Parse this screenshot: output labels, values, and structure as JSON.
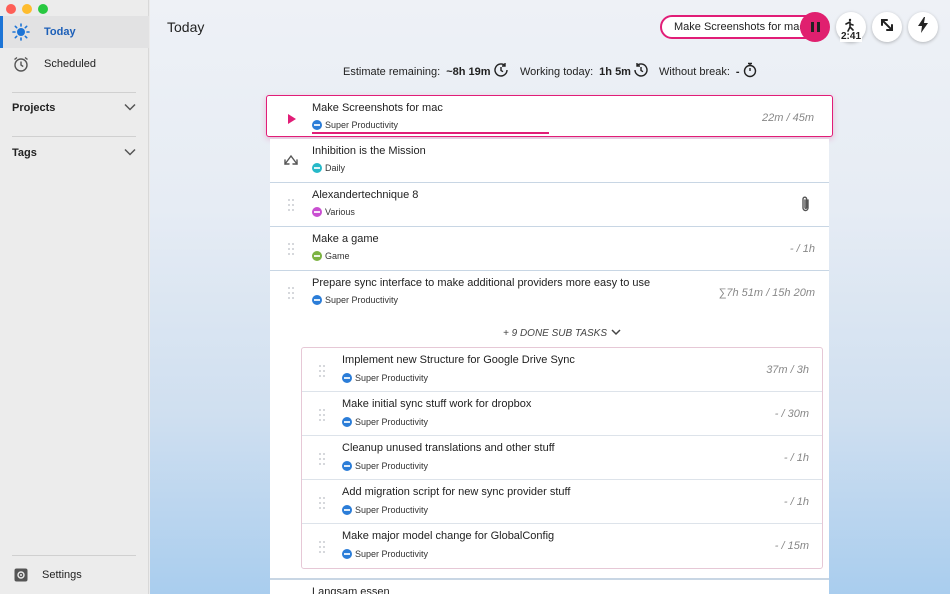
{
  "sidebar": {
    "today": "Today",
    "scheduled": "Scheduled",
    "projects": "Projects",
    "tags": "Tags",
    "settings": "Settings"
  },
  "header": {
    "title": "Today",
    "current_task": "Make Screenshots for mac",
    "timer_badge": "2:41"
  },
  "stats": {
    "estimate_label": "Estimate remaining:",
    "estimate_value": "~8h 19m",
    "working_label": "Working today:",
    "working_value": "1h 5m",
    "break_label": "Without break:",
    "break_value": "-"
  },
  "colors": {
    "accent": "#e11d77",
    "super_productivity": "#2b7dd8",
    "daily": "#26b9c8",
    "various": "#c94fd1",
    "game": "#7cb342"
  },
  "tasks": [
    {
      "title": "Make Screenshots for mac",
      "project": "Super Productivity",
      "time": "22m / 45m",
      "progress": 0.49
    },
    {
      "title": "Inhibition is the Mission",
      "project": "Daily",
      "time": ""
    },
    {
      "title": "Alexandertechnique 8",
      "project": "Various",
      "time": ""
    },
    {
      "title": "Make a game",
      "project": "Game",
      "time": "- / 1h"
    },
    {
      "title": "Prepare sync interface to make additional providers more easy to use",
      "project": "Super Productivity",
      "time": "∑7h 51m / 15h 20m"
    }
  ],
  "subtasks_toggle": "+ 9 DONE SUB TASKS",
  "subtasks": [
    {
      "title": "Implement new Structure for Google Drive Sync",
      "project": "Super Productivity",
      "time": "37m / 3h"
    },
    {
      "title": "Make initial sync stuff work for dropbox",
      "project": "Super Productivity",
      "time": "- / 30m"
    },
    {
      "title": "Cleanup unused translations and other stuff",
      "project": "Super Productivity",
      "time": "- / 1h"
    },
    {
      "title": "Add migration script for new sync provider stuff",
      "project": "Super Productivity",
      "time": "- / 1h"
    },
    {
      "title": "Make major model change for GlobalConfig",
      "project": "Super Productivity",
      "time": "- / 15m"
    }
  ],
  "last_task": {
    "title": "Langsam essen"
  }
}
